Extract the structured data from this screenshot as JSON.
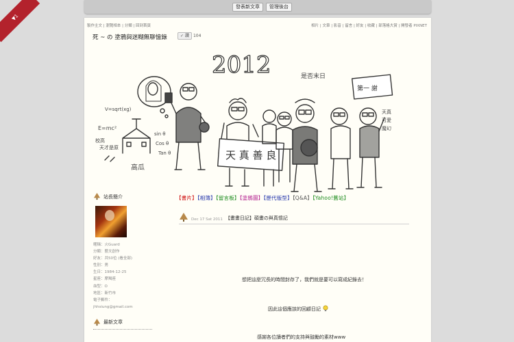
{
  "topbar": {
    "buttons": [
      "發表新文章",
      "管理後台"
    ]
  },
  "corner_badge": "▼1",
  "metaline": {
    "left": "製作主文 | 瀏覽相本 | 分類 | 回到首頁",
    "right": "相片 | 文章 | 影音 | 留言 | 好友 | 收藏 | 部落格大賞 | 開發者 PIXNET"
  },
  "blog_title": "死 ~ の 塗鴉與迷糊無聊憶錄",
  "like": {
    "label": "讚",
    "count": "104"
  },
  "sidebar": {
    "profile_title": "站長簡介",
    "profile_lines": [
      "暱稱：火Guard",
      "分類：藝文創作",
      "好友：共50位 (看全部)",
      "性別：男",
      "生日：1984-12-25",
      "星座：摩羯座",
      "血型：O",
      "地區：新竹市",
      "電子郵件：",
      "jhhsiung@gmail.com"
    ],
    "recent_title": "最新文章"
  },
  "main": {
    "nav": [
      {
        "text": "【書片】",
        "color": "#cc0000"
      },
      {
        "text": "【相簿】",
        "color": "#2233aa"
      },
      {
        "text": "【留言板】",
        "color": "#1a8a1a"
      },
      {
        "text": "【塗鴉圖】",
        "color": "#b0168a"
      },
      {
        "text": "【歷代版型】",
        "color": "#2233aa"
      },
      {
        "text": "【Q&A】",
        "color": "#555555"
      },
      {
        "text": "【Yahoo!舊站】",
        "color": "#1a8a1a"
      }
    ],
    "post": {
      "date": "Dec 17 Sat 2011",
      "title": "【畫畫日記】碩畫の與真憶記",
      "lines": [
        "想把這麼冗長的時間封存了，我們就是要可以寫成紀錄去！",
        "因此這個應該的回顧日記",
        "感謝各位讀者們的支持與鼓勵的素材www"
      ]
    }
  },
  "banner": {
    "year": "2012",
    "year_note": "是否末日",
    "sign": "天 真 善 良",
    "doodle_left": [
      "V=sqrt(xg)",
      "E=mc²",
      "sin θ",
      "Cos θ",
      "Tan θ",
      "校高",
      "天才是原",
      "高瓜"
    ],
    "doodle_right": [
      "第一 謝",
      "天真",
      "可愛",
      "魔幻"
    ]
  }
}
